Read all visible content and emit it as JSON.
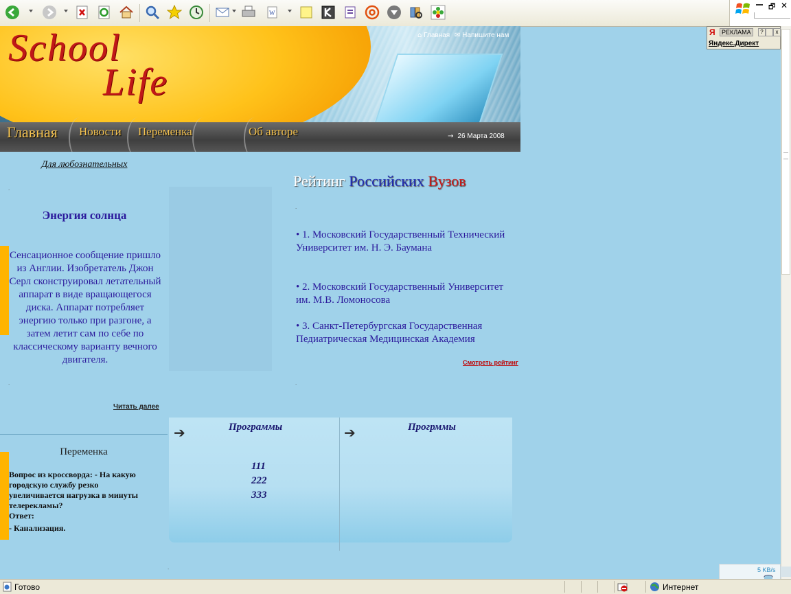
{
  "header": {
    "logo": {
      "line1": "School",
      "line2": "Life"
    },
    "top_links": [
      {
        "label": "Главная"
      },
      {
        "label": "Напишите нам"
      }
    ],
    "nav": [
      {
        "label": "Главная"
      },
      {
        "label": "Новости"
      },
      {
        "label": "Переменка"
      },
      {
        "label": "Об авторе"
      }
    ],
    "date": "26 Марта 2008"
  },
  "left": {
    "tagline": "Для любознательных",
    "article": {
      "title": "Энергия солнца",
      "body": "Сенсационное сообщение пришло из Англии. Изобретатель Джон Серл сконструировал летательный аппарат в виде вращающегося диска. Аппарат потребляет энергию только при разгоне, а затем летит сам по себе по классическому варианту вечного двигателя.",
      "read_more": "Читать далее"
    },
    "break_section": {
      "title": "Переменка",
      "question": "Вопрос из кроссворда: - На какую городскую службу резко увеличивается нагрузка в минуты телерекламы?",
      "answer_label": "Ответ:",
      "answer": "- Канализация."
    }
  },
  "rating": {
    "title_parts": [
      "Рейтинг",
      "Российских",
      "Вузов"
    ],
    "items": [
      "1. Московский Государственный Технический Университет им. Н. Э. Баумана",
      "2. Московский Государственный Университет им. М.В. Ломоносова",
      "3. Санкт-Петербургская Государственная Педиатрическая Медицинская Академия"
    ],
    "link": "Смотреть рейтинг"
  },
  "programs": {
    "col1_title": "Программы",
    "col2_title": "Прогрммы",
    "items": [
      "111",
      "222",
      "333"
    ]
  },
  "ad": {
    "label": "РЕКЛАМА",
    "title": "Яндекс.Директ",
    "help": "?",
    "close": "x"
  },
  "status": {
    "text": "Готово",
    "zone": "Интернет",
    "speed": "5 KB/s"
  },
  "colors": {
    "page_bg": "#a0d2ea",
    "text_blue": "#2b1a9c",
    "link_red": "#c00000",
    "nav_gold": "#f6c451",
    "accent_orange": "#ffb400"
  }
}
